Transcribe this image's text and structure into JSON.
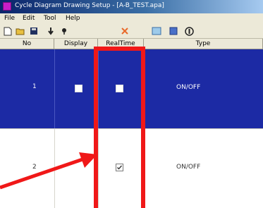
{
  "window": {
    "title": "Cycle Diagram Drawing Setup - [A-B_TEST.apa]"
  },
  "menu": [
    "File",
    "Edit",
    "Tool",
    "Help"
  ],
  "toolbar": {
    "icons": [
      "new-file-icon",
      "open-folder-icon",
      "save-disk-icon",
      "arrow-down-icon",
      "pin-icon",
      "delete-x-icon",
      "window-icon",
      "grid-icon",
      "info-icon"
    ]
  },
  "grid": {
    "columns": [
      "No",
      "Display",
      "RealTime",
      "Type"
    ],
    "rows": [
      {
        "no": "1",
        "display_checked": false,
        "realtime_checked": false,
        "type": "ON/OFF",
        "selected": true
      },
      {
        "no": "2",
        "display_checked": false,
        "realtime_checked": true,
        "type": "ON/OFF",
        "selected": false
      }
    ]
  },
  "annotation": {
    "color": "#f01818"
  }
}
